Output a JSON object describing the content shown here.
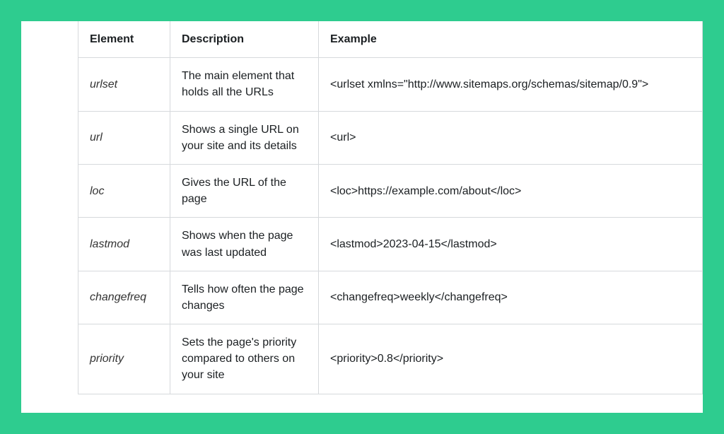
{
  "table": {
    "headers": {
      "element": "Element",
      "description": "Description",
      "example": "Example"
    },
    "rows": [
      {
        "element": "urlset",
        "description": "The main element that holds all the URLs",
        "example": "<urlset xmlns=\"http://www.sitemaps.org/schemas/sitemap/0.9\">"
      },
      {
        "element": "url",
        "description": "Shows a single URL on your site and its details",
        "example": "<url>"
      },
      {
        "element": "loc",
        "description": "Gives the URL of the page",
        "example": "<loc>https://example.com/about</loc>"
      },
      {
        "element": "lastmod",
        "description": "Shows when the page was last updated",
        "example": "<lastmod>2023-04-15</lastmod>"
      },
      {
        "element": "changefreq",
        "description": "Tells how often the page changes",
        "example": "<changefreq>weekly</changefreq>"
      },
      {
        "element": "priority",
        "description": "Sets the page's priority compared to others on your site",
        "example": "<priority>0.8</priority>"
      }
    ]
  }
}
